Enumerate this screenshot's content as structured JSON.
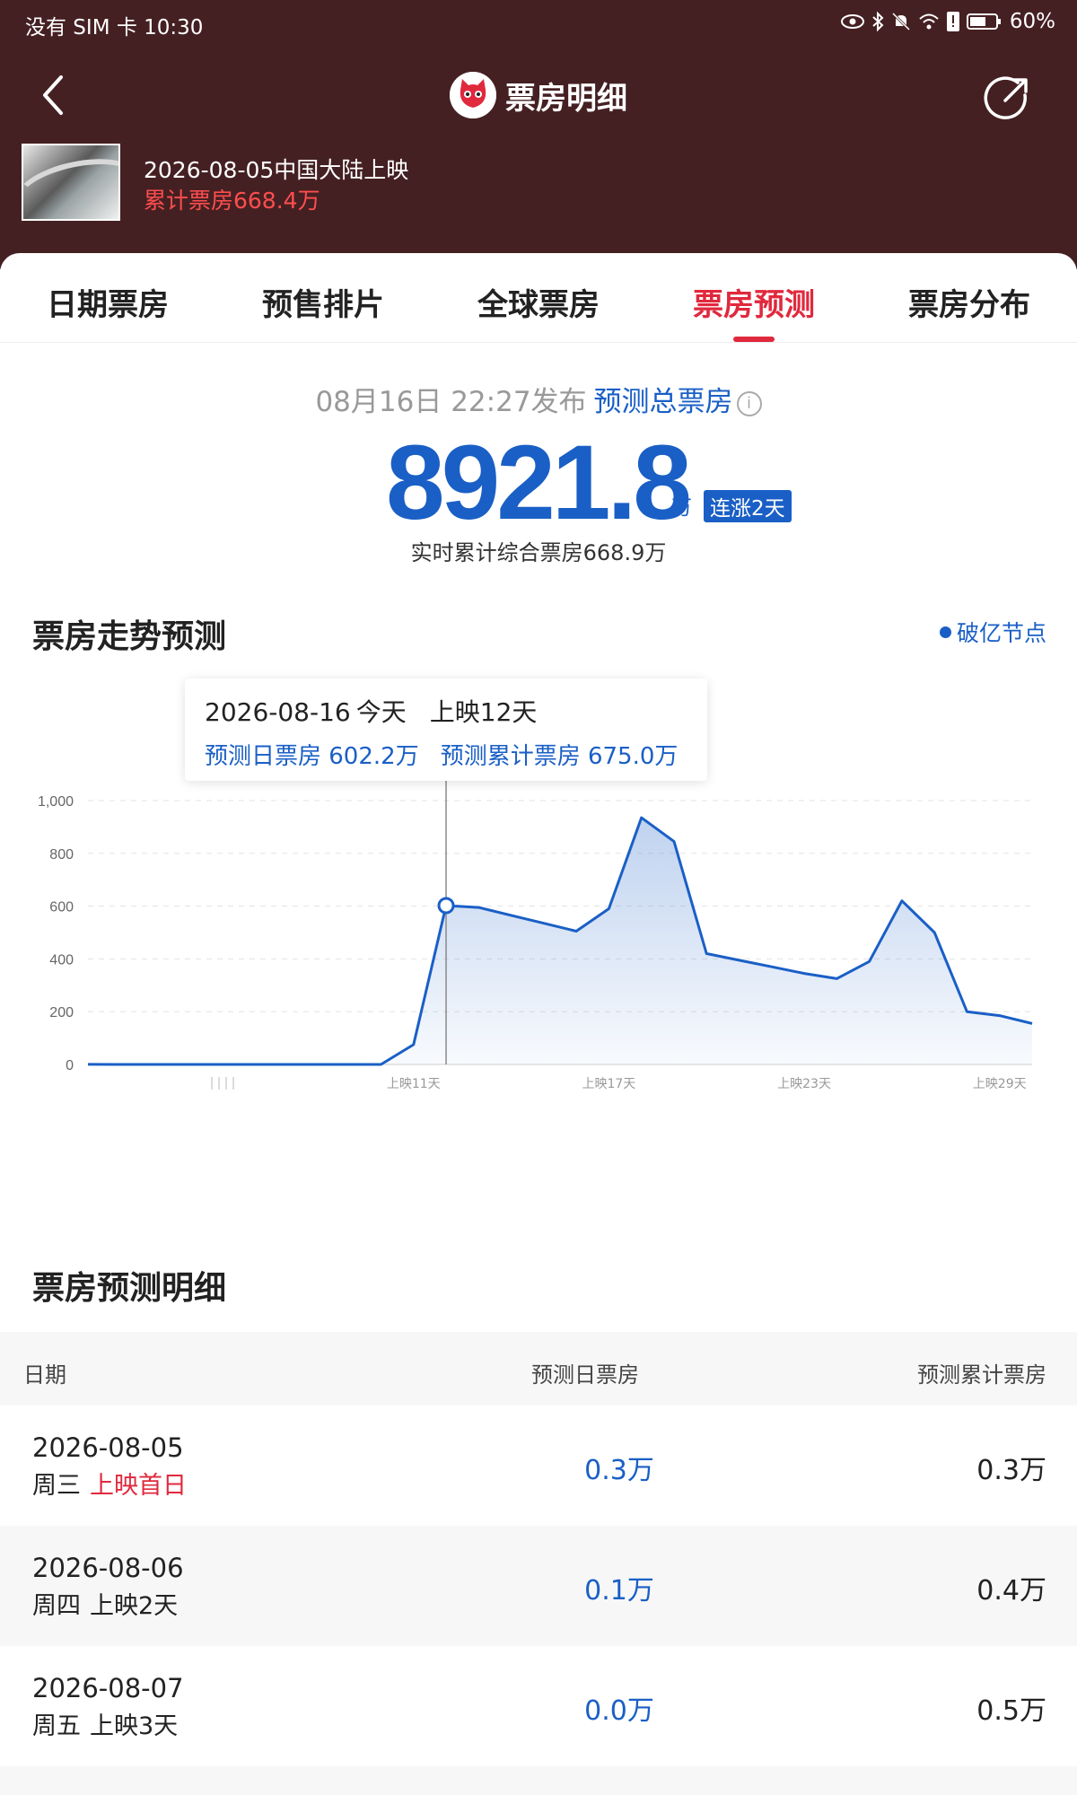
{
  "status_bar": {
    "left": "没有 SIM 卡 10:30",
    "battery": "60%"
  },
  "header": {
    "title": "票房明细",
    "movie_date": "2026-08-05中国大陆上映",
    "movie_total": "累计票房668.4万"
  },
  "tabs": [
    {
      "label": "日期票房"
    },
    {
      "label": "预售排片"
    },
    {
      "label": "全球票房"
    },
    {
      "label": "票房预测",
      "active": true
    },
    {
      "label": "票房分布"
    }
  ],
  "summary": {
    "publish": "08月16日 22:27发布",
    "forecast_label": "预测总票房",
    "total": "8921.8",
    "unit": "万",
    "badge": "连涨2天",
    "realtime": "实时累计综合票房668.9万"
  },
  "trend": {
    "title": "票房走势预测",
    "legend": "破亿节点",
    "tooltip": {
      "date": "2026-08-16",
      "today": "今天",
      "days": "上映12天",
      "daily": "预测日票房 602.2万",
      "cumulative": "预测累计票房 675.0万"
    }
  },
  "chart_data": {
    "type": "area",
    "y_ticks": [
      "0",
      "200",
      "400",
      "600",
      "800",
      "1,000"
    ],
    "x_ticks": [
      {
        "day": 11,
        "label": "上映11天"
      },
      {
        "day": 17,
        "label": "上映17天"
      },
      {
        "day": 23,
        "label": "上映23天"
      },
      {
        "day": 29,
        "label": "上映29天"
      }
    ],
    "ylim": [
      0,
      1000
    ],
    "x_range": [
      1,
      30
    ],
    "grid": true,
    "highlight_day": 12,
    "x": [
      1,
      2,
      3,
      4,
      5,
      6,
      7,
      8,
      9,
      10,
      11,
      12,
      13,
      14,
      15,
      16,
      17,
      18,
      19,
      20,
      21,
      22,
      23,
      24,
      25,
      26,
      27,
      28,
      29,
      30
    ],
    "values": [
      0.3,
      0.1,
      0.0,
      0,
      0,
      0,
      0,
      0,
      0,
      0,
      75,
      602,
      595,
      565,
      535,
      505,
      590,
      935,
      845,
      420,
      395,
      370,
      345,
      325,
      390,
      620,
      500,
      200,
      185,
      155
    ],
    "series": [
      {
        "name": "预测日票房",
        "color": "#1a5fc6"
      }
    ]
  },
  "detail": {
    "title": "票房预测明细",
    "headers": {
      "date": "日期",
      "daily": "预测日票房",
      "cumulative": "预测累计票房"
    },
    "rows": [
      {
        "date": "2026-08-05",
        "weekday": "周三",
        "tag": "上映首日",
        "tag_red": true,
        "daily": "0.3万",
        "cumulative": "0.3万"
      },
      {
        "date": "2026-08-06",
        "weekday": "周四",
        "tag": "上映2天",
        "tag_red": false,
        "daily": "0.1万",
        "cumulative": "0.4万"
      },
      {
        "date": "2026-08-07",
        "weekday": "周五",
        "tag": "上映3天",
        "tag_red": false,
        "daily": "0.0万",
        "cumulative": "0.5万"
      }
    ]
  }
}
